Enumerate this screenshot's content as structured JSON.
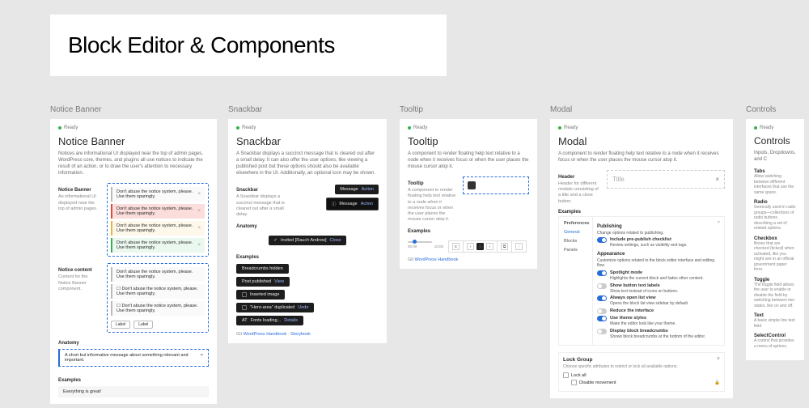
{
  "title": "Block Editor & Components",
  "status_label": "Ready",
  "sections": {
    "notice": {
      "label": "Notice Banner",
      "heading": "Notice Banner",
      "desc": "Notices are informational UI displayed near the top of admin pages. WordPress core, themes, and plugins all use notices to indicate the result of an action, or to draw the user's attention to necessary information.",
      "sub1": "Notice Banner",
      "sub1_desc": "An informational UI displayed near the top of admin pages.",
      "line_text": "Don't abuse the notice system, please. Use them sparingly.",
      "sub2": "Notice content",
      "sub2_desc": "Content for the Notice Banner component.",
      "btn_label": "Label",
      "anatomy": "Anatomy",
      "anatomy_text": "A short but informative message about something relevant and important.",
      "examples": "Examples",
      "example_text": "Everything is great!"
    },
    "snackbar": {
      "label": "Snackbar",
      "heading": "Snackbar",
      "desc": "A Snackbar displays a succinct message that is cleared out after a small delay. It can also offer the user options, like viewing a published post but these options should also be available elsewhere in the UI. Additionally, an optional icon may be shown.",
      "sub": "Snackbar",
      "sub_desc": "A Snackbar displays a succinct message that is cleared out after a small delay.",
      "message": "Message",
      "action": "Action",
      "anatomy": "Anatomy",
      "invited": "Invited [Rauch Andrew]",
      "close": "Close",
      "examples": "Examples",
      "pills": {
        "breadcrumbs": "Breadcrumbs hidden",
        "published": "Post published",
        "view": "View",
        "inserted": "Inserted image",
        "hero": "\"Hero-area\" duplicated",
        "undo": "Undo",
        "fonts": "Fonts loading...",
        "details": "Details"
      },
      "footer_prefix": "Git",
      "footer_links": [
        "WordPress Handbook",
        "Storybook"
      ]
    },
    "tooltip": {
      "label": "Tooltip",
      "heading": "Tooltip",
      "desc": "A component to render floating help text relative to a node when it receives focus or when the user places the mouse cursor atop it.",
      "sub": "Tooltip",
      "sub_desc": "A component to render floating help text relative to a node when it receives focus or when the user places the mouse cursor atop it.",
      "examples": "Examples",
      "time1": "00:00",
      "time2": "10:00",
      "footer": "WordPress Handbook"
    },
    "modal": {
      "label": "Modal",
      "heading": "Modal",
      "desc": "A component to render floating help text relative to a node when it receives focus or when the user places the mouse cursor atop it.",
      "header_sub": "Header",
      "header_desc": "Header for different modals consisting of a title and a close button.",
      "title_placeholder": "Title",
      "examples": "Examples",
      "prefs_title": "Preferences",
      "prefs_tabs": [
        "General",
        "Blocks",
        "Panels"
      ],
      "publishing": "Publishing",
      "pub_desc": "Change options related to publishing.",
      "pub_item": "Include pre-publish checklist",
      "pub_item_desc": "Review settings, such as visibility and tags.",
      "appearance": "Appearance",
      "app_desc": "Customize options related to the block editor interface and editing flow.",
      "app_items": [
        {
          "t": "Spotlight mode",
          "d": "Highlights the current block and fades other content."
        },
        {
          "t": "Show button text labels",
          "d": "Show text instead of icons on buttons."
        },
        {
          "t": "Always open list view",
          "d": "Opens the block list view sidebar by default."
        },
        {
          "t": "Reduce the interface",
          "d": ""
        },
        {
          "t": "Use theme styles",
          "d": "Make the editor look like your theme."
        },
        {
          "t": "Display block breadcrumbs",
          "d": "Shows block breadcrumbs at the bottom of the editor."
        }
      ],
      "lock_title": "Lock Group",
      "lock_desc": "Choose specific attributes to restrict or lock all available options.",
      "lock_all": "Lock all",
      "lock_move": "Disable movement"
    },
    "controls": {
      "label": "Controls",
      "heading": "Controls",
      "desc": "Inputs, Dropdowns, and C",
      "items": [
        {
          "h": "Tabs",
          "d": "Allow switching between different interfaces that use the same space."
        },
        {
          "h": "Radio",
          "d": "Generally used in radio groups—collections of radio buttons describing a set of related options."
        },
        {
          "h": "Checkbox",
          "d": "Boxes that are checked (ticked) when activated, like you might see in an official government paper form."
        },
        {
          "h": "Toggle",
          "d": "The toggle field allows the user to enable or disable the field by switching between two states, like on and off."
        },
        {
          "h": "Text",
          "d": "A basic simple line text field"
        },
        {
          "h": "SelectControl",
          "d": "A control that provides a menu of options."
        }
      ]
    }
  }
}
